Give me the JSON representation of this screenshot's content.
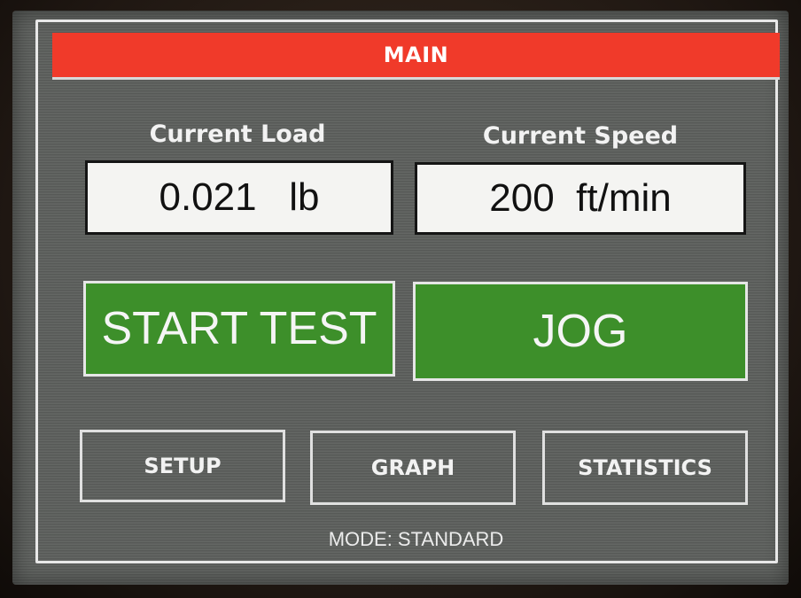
{
  "header": {
    "title": "MAIN"
  },
  "readouts": {
    "load_label": "Current Load",
    "load_value": "0.021   lb",
    "speed_label": "Current Speed",
    "speed_value": "200  ft/min"
  },
  "actions": {
    "start_test": "START TEST",
    "jog": "JOG"
  },
  "nav": {
    "setup": "SETUP",
    "graph": "GRAPH",
    "statistics": "STATISTICS"
  },
  "footer": {
    "mode": "MODE: STANDARD"
  },
  "colors": {
    "title_bar": "#f03a2a",
    "action_button": "#3d8f2a",
    "screen_background": "#5c5f5c"
  }
}
